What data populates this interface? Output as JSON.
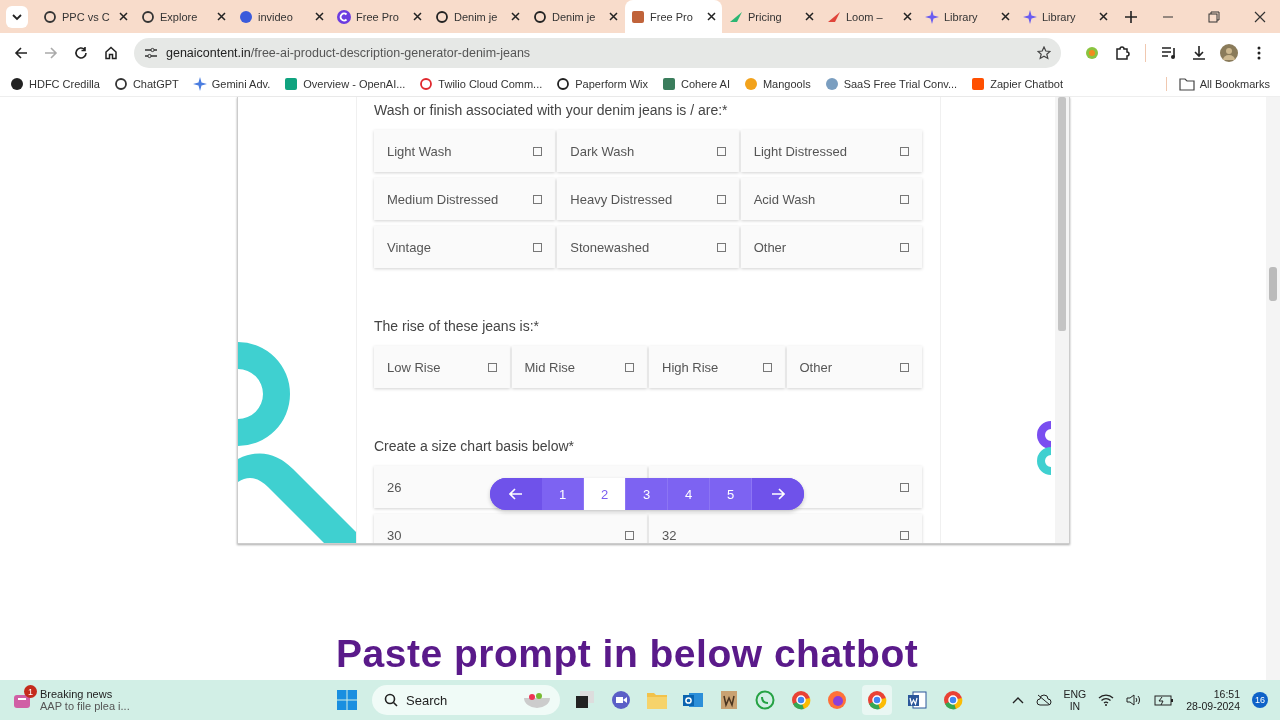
{
  "tabs": [
    {
      "title": "PPC vs C",
      "selected": false
    },
    {
      "title": "Explore",
      "selected": false
    },
    {
      "title": "invideo",
      "selected": false
    },
    {
      "title": "Free Pro",
      "selected": false
    },
    {
      "title": "Denim je",
      "selected": false
    },
    {
      "title": "Denim je",
      "selected": false
    },
    {
      "title": "Free Pro",
      "selected": true
    },
    {
      "title": "Pricing",
      "selected": false
    },
    {
      "title": "Loom –",
      "selected": false
    },
    {
      "title": "Library",
      "selected": false
    },
    {
      "title": "Library",
      "selected": false
    }
  ],
  "address": {
    "domain": "genaicontent.in",
    "path": "/free-ai-product-description-generator-denim-jeans"
  },
  "bookmarks": [
    {
      "label": "HDFC Credilla"
    },
    {
      "label": "ChatGPT"
    },
    {
      "label": "Gemini Adv."
    },
    {
      "label": "Overview - OpenAI..."
    },
    {
      "label": "Twilio Cloud Comm..."
    },
    {
      "label": "Paperform Wix"
    },
    {
      "label": "Cohere AI"
    },
    {
      "label": "Mangools"
    },
    {
      "label": "SaaS Free Trial Conv..."
    },
    {
      "label": "Zapier Chatbot"
    }
  ],
  "all_bookmarks": "All Bookmarks",
  "questions": [
    {
      "prompt": "Wash or finish associated with your denim jeans is / are:*",
      "options": [
        {
          "label": "Light Wash",
          "checked": false
        },
        {
          "label": "Dark Wash",
          "checked": false
        },
        {
          "label": "Light Distressed",
          "checked": false
        },
        {
          "label": "Medium Distressed",
          "checked": false
        },
        {
          "label": "Heavy Distressed",
          "checked": false
        },
        {
          "label": "Acid Wash",
          "checked": false
        },
        {
          "label": "Vintage",
          "checked": false
        },
        {
          "label": "Stonewashed",
          "checked": false
        },
        {
          "label": "Other",
          "checked": false
        }
      ]
    },
    {
      "prompt": "The rise of these jeans is:*",
      "options": [
        {
          "label": "Low Rise",
          "checked": false
        },
        {
          "label": "Mid Rise",
          "checked": false
        },
        {
          "label": "High Rise",
          "checked": false
        },
        {
          "label": "Other",
          "checked": false
        }
      ]
    },
    {
      "prompt": "Create a size chart basis below*",
      "options": [
        {
          "label": "26"
        },
        {
          "checked": false
        },
        {
          "label": "30",
          "checked": false
        },
        {
          "label": "32",
          "checked": false
        }
      ]
    }
  ],
  "pages": [
    {
      "label": "1",
      "selected": false
    },
    {
      "label": "2",
      "selected": true
    },
    {
      "label": "3",
      "selected": false
    },
    {
      "label": "4",
      "selected": false
    },
    {
      "label": "5",
      "selected": false
    }
  ],
  "heading": "Paste prompt in below chatbot",
  "taskbar": {
    "news_badge": "1",
    "news_title": "Breaking news",
    "news_text": "AAP to file plea i...",
    "search": "Search",
    "lang": "ENG",
    "region": "IN",
    "time": "16:51",
    "date": "28-09-2024",
    "notifications": "16"
  }
}
